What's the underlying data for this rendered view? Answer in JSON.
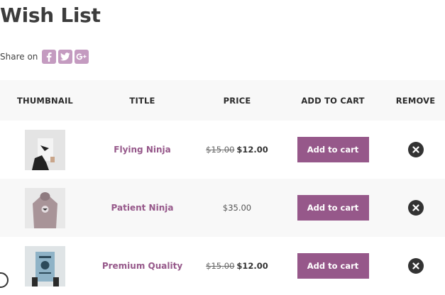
{
  "page": {
    "title": "Wish List"
  },
  "share": {
    "label": "Share on",
    "networks": [
      {
        "name": "facebook-icon",
        "color": "#c49bc0"
      },
      {
        "name": "twitter-icon",
        "color": "#c49bc0"
      },
      {
        "name": "google-plus-icon",
        "color": "#c49bc0"
      }
    ]
  },
  "table": {
    "headers": {
      "thumbnail": "THUMBNAIL",
      "title": "TITLE",
      "price": "PRICE",
      "add_to_cart": "ADD TO CART",
      "remove": "REMOVE"
    },
    "rows": [
      {
        "title": "Flying Ninja",
        "price_old": "$15.00",
        "price_new": "$12.00",
        "button": "Add to cart"
      },
      {
        "title": "Patient Ninja",
        "price_old": "",
        "price_new": "$35.00",
        "button": "Add to cart"
      },
      {
        "title": "Premium Quality",
        "price_old": "$15.00",
        "price_new": "$12.00",
        "button": "Add to cart"
      }
    ]
  },
  "colors": {
    "accent": "#96588a",
    "social": "#c49bc0",
    "header_bg": "#f8f8f8"
  }
}
